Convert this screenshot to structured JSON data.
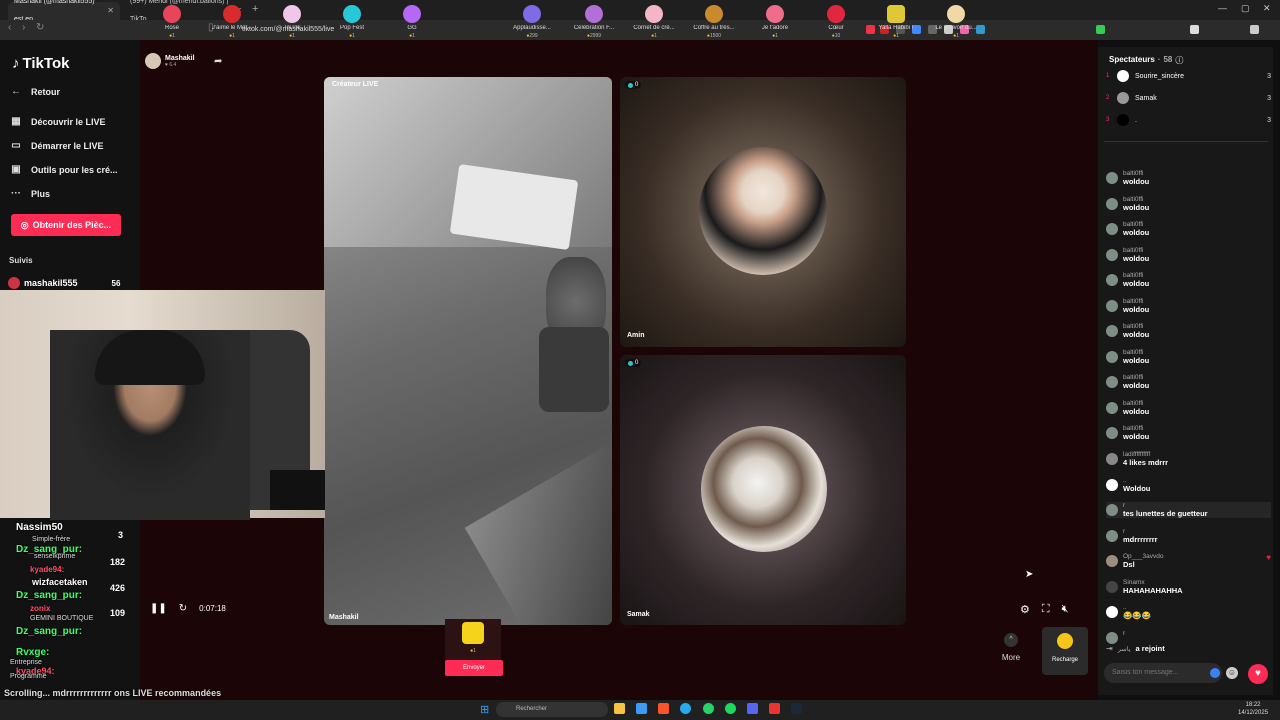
{
  "browser": {
    "tabs": [
      {
        "title": "Mashakil (@mashakil555) est en ..."
      },
      {
        "title": "(99+) Mehdi (@mehdi.ballons) | TikTo..."
      }
    ],
    "url": "tiktok.com/@mashakil555/live"
  },
  "sidebar": {
    "logo": "TikTok",
    "items": [
      {
        "label": "Retour",
        "icon": "arrow-left-icon"
      },
      {
        "label": "Découvrir le LIVE",
        "icon": "calendar-live-icon"
      },
      {
        "label": "Démarrer le LIVE",
        "icon": "video-icon"
      },
      {
        "label": "Outils pour les cré...",
        "icon": "tools-icon"
      },
      {
        "label": "Plus",
        "icon": "more-icon"
      }
    ],
    "coins_button": "Obtenir des Pièc...",
    "followed_title": "Suivis",
    "followed": [
      {
        "name": "mashakil555",
        "count": "56"
      }
    ]
  },
  "host": {
    "name": "Mashakil",
    "likes": "6.4"
  },
  "panels": {
    "main": {
      "label": "Créateur LIVE",
      "bottom_label": "Mashakil"
    },
    "amin": {
      "name": "Amin",
      "count": "0"
    },
    "samak": {
      "name": "Samak",
      "count": "0"
    }
  },
  "overlay_chat": [
    {
      "name": "Nassim50",
      "sub": "Simple-frère",
      "color": "#ffd23f",
      "num": "3"
    },
    {
      "name": "Dz_sang_pur:",
      "sub": "senseikprime",
      "color": "#3cff6b",
      "num": "182"
    },
    {
      "name": "kyade94:",
      "sub": "",
      "color": "#ff4f6a",
      "num": ""
    },
    {
      "name": "wizfacetaken",
      "sub": "",
      "color": "#ffffff",
      "num": "426"
    },
    {
      "name": "Dz_sang_pur:",
      "sub": "",
      "color": "#3cff6b",
      "num": ""
    },
    {
      "name": "zonix",
      "sub": "GEMINI BOUTIQUE",
      "color": "#ff4f6a",
      "num": "109"
    },
    {
      "name": "Dz_sang_pur:",
      "sub": "",
      "color": "#3cff6b",
      "num": ""
    },
    {
      "name": "Rvxge:",
      "sub": "Entreprise",
      "color": "#3cff6b",
      "num": ""
    },
    {
      "name": "kyade94:",
      "sub": "Programme",
      "color": "#ff4f6a",
      "num": ""
    }
  ],
  "bottom_text": "Scrolling...   mdrrrrrrrrrrrrr   ons LIVE recommandées",
  "player": {
    "time": "0:07:18"
  },
  "gifts": [
    {
      "name": "Rose",
      "price": "1",
      "color": "#e8455b"
    },
    {
      "name": "J'aime le Mar...",
      "price": "1",
      "color": "#d92b2b"
    },
    {
      "name": "TikTok",
      "price": "1",
      "color": "#f1c6e8"
    },
    {
      "name": "Pop Fest",
      "price": "1",
      "color": "#27c7d8"
    },
    {
      "name": "GG",
      "price": "1",
      "color": "#b567f5"
    },
    {
      "name": "",
      "price": "1",
      "color": "#f5d31c"
    },
    {
      "name": "Applaudisse...",
      "price": "299",
      "color": "#7e6ce6"
    },
    {
      "name": "Célébration F...",
      "price": "2999",
      "color": "#b26fd6"
    },
    {
      "name": "Cornet de crè...",
      "price": "1",
      "color": "#f4b6c7"
    },
    {
      "name": "Coffre au trés...",
      "price": "1500",
      "color": "#c9892d"
    },
    {
      "name": "Je t'adore",
      "price": "1",
      "color": "#f06d8a"
    },
    {
      "name": "Cœur",
      "price": "10",
      "color": "#e3263f"
    },
    {
      "name": "Yalla Habibi !",
      "price": "1",
      "color": "#dfc836"
    },
    {
      "name": "Le pouvoir du...",
      "price": "1",
      "color": "#f1d8a6"
    }
  ],
  "send_label": "Envoyer",
  "more_label": "More",
  "recharge_label": "Recharge",
  "viewers": {
    "title": "Spectateurs",
    "count": "58",
    "top": [
      {
        "rank": "1",
        "name": "Sourire_sincère",
        "count": "3"
      },
      {
        "rank": "2",
        "name": "Samak",
        "count": "3"
      },
      {
        "rank": "3",
        "name": ".",
        "count": "3"
      }
    ]
  },
  "comments": [
    {
      "name": "balti0ffi",
      "text": "woldou"
    },
    {
      "name": "balti0ffi",
      "text": "woldou"
    },
    {
      "name": "balti0ffi",
      "text": "woldou"
    },
    {
      "name": "balti0ffi",
      "text": "woldou"
    },
    {
      "name": "balti0ffi",
      "text": "woldou"
    },
    {
      "name": "balti0ffi",
      "text": "woldou"
    },
    {
      "name": "balti0ffi",
      "text": "woldou"
    },
    {
      "name": "balti0ffi",
      "text": "woldou"
    },
    {
      "name": "balti0ffi",
      "text": "woldou"
    },
    {
      "name": "balti0ffi",
      "text": "woldou"
    },
    {
      "name": "balti0ffi",
      "text": "woldou"
    },
    {
      "name": "ladiffffffffff",
      "text": "4 likes mdrrr"
    },
    {
      "name": "..",
      "text": "Woldou"
    },
    {
      "name": "r",
      "text": "tes lunettes de guetteur"
    },
    {
      "name": "r",
      "text": "mdrrrrrrrr"
    },
    {
      "name": "Op___3avvdo",
      "text": "Dsl"
    },
    {
      "name": "Sinamx",
      "text": "HAHAHAHAHHA"
    },
    {
      "name": "..",
      "text": "😂😂😂"
    },
    {
      "name": "r",
      "text": ""
    },
    {
      "name": "ياسر",
      "text": "a rejoint"
    }
  ],
  "chat_placeholder": "Saisis ton message...",
  "taskbar": {
    "search": "Rechercher",
    "time": "18:22",
    "date": "14/12/2025"
  }
}
